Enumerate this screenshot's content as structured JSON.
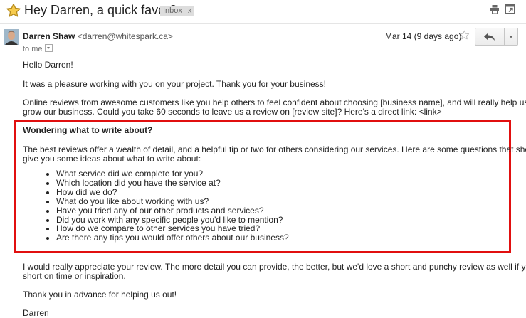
{
  "header": {
    "subject": "Hey Darren, a quick favor?",
    "label": "Inbox",
    "label_close": "x"
  },
  "message": {
    "sender_name": "Darren Shaw",
    "sender_email": "<darren@whitespark.ca>",
    "date": "Mar 14 (9 days ago)",
    "to": "to me"
  },
  "body": {
    "greeting": "Hello Darren!",
    "thanks": "It was a pleasure working with you on your project. Thank you for your business!",
    "request_line1": "Online reviews from awesome customers like you help others to feel confident about choosing [business name], and will really help us",
    "request_line2": "grow our business. Could you take 60 seconds to leave us a review on [review site]? Here's a direct link: <link>",
    "box_heading": "Wondering what to write about?",
    "box_intro_line1": "The best reviews offer a wealth of detail, and a helpful tip or two for others considering our services. Here are some questions that should",
    "box_intro_line2": "give you some ideas about what to write about:",
    "questions": [
      "What service did we complete for you?",
      "Which location did you have the service at?",
      "How did we do?",
      "What do you like about working with us?",
      "Have you tried any of our other products and services?",
      "Did you work with any specific people you'd like to mention?",
      "How do we compare to other services you have tried?",
      "Are there any tips you would offer others about our business?"
    ],
    "closing_line1": "I would really appreciate your review. The more detail you can provide, the better, but we'd love a short and punchy review as well if you're",
    "closing_line2": "short on time or inspiration.",
    "thanks_advance": "Thank you in advance for helping us out!",
    "signature": "Darren"
  },
  "colors": {
    "highlight_border": "#e10f0f",
    "star_fill": "#f7cb4d",
    "label_bg": "#dddddd"
  },
  "icons": [
    "star-icon",
    "print-icon",
    "new-window-icon",
    "star-outline-icon",
    "reply-icon",
    "chevron-down-icon"
  ]
}
